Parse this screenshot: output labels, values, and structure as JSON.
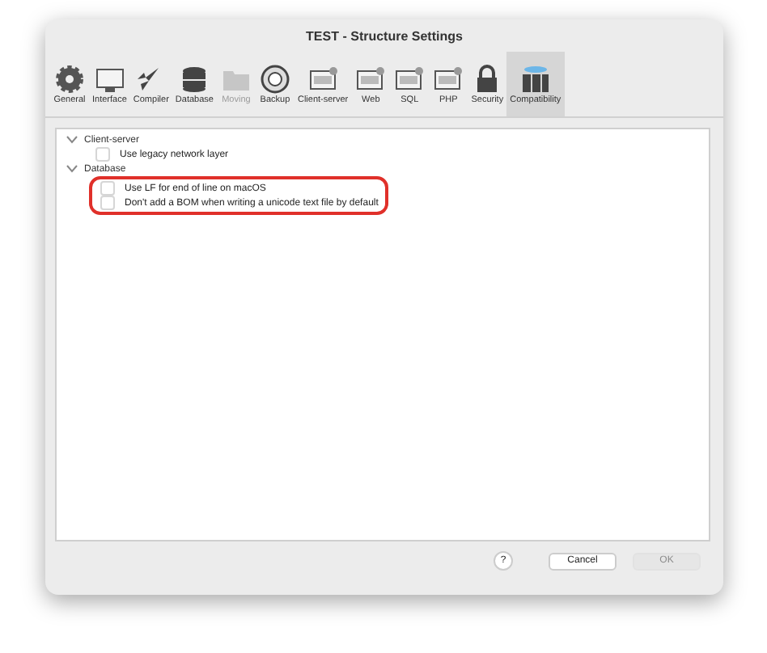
{
  "window": {
    "title": "TEST - Structure Settings"
  },
  "toolbar": [
    {
      "label": "General",
      "selected": false,
      "disabled": false
    },
    {
      "label": "Interface",
      "selected": false,
      "disabled": false
    },
    {
      "label": "Compiler",
      "selected": false,
      "disabled": false
    },
    {
      "label": "Database",
      "selected": false,
      "disabled": false
    },
    {
      "label": "Moving",
      "selected": false,
      "disabled": true
    },
    {
      "label": "Backup",
      "selected": false,
      "disabled": false
    },
    {
      "label": "Client-server",
      "selected": false,
      "disabled": false
    },
    {
      "label": "Web",
      "selected": false,
      "disabled": false
    },
    {
      "label": "SQL",
      "selected": false,
      "disabled": false
    },
    {
      "label": "PHP",
      "selected": false,
      "disabled": false
    },
    {
      "label": "Security",
      "selected": false,
      "disabled": false
    },
    {
      "label": "Compatibility",
      "selected": true,
      "disabled": false
    }
  ],
  "groups": [
    {
      "label": "Client-server",
      "expanded": true,
      "highlighted": false,
      "children": [
        {
          "label": "Use legacy network layer",
          "checked": false
        }
      ]
    },
    {
      "label": "Database",
      "expanded": true,
      "highlighted": true,
      "children": [
        {
          "label": "Use LF for end of line on macOS",
          "checked": false
        },
        {
          "label": "Don't add a BOM when writing a unicode text file by default",
          "checked": false
        }
      ]
    }
  ],
  "buttons": [
    {
      "label": "?",
      "kind": "help"
    },
    {
      "label": "Cancel",
      "kind": "normal",
      "disabled": false
    },
    {
      "label": "OK",
      "kind": "normal",
      "disabled": true
    }
  ]
}
